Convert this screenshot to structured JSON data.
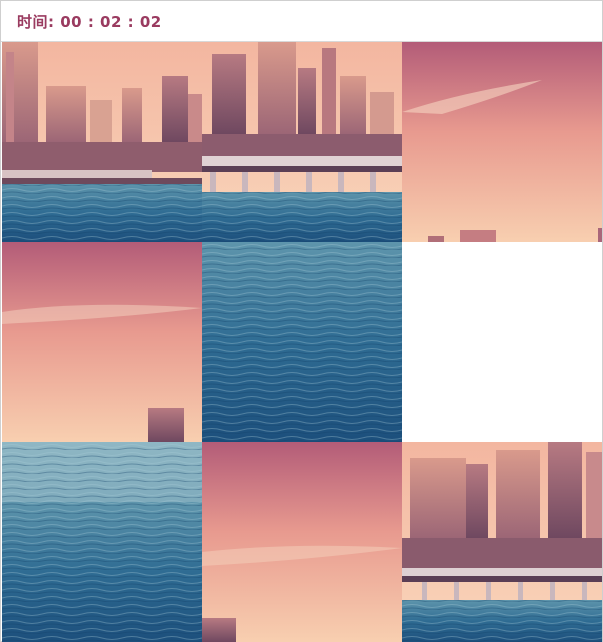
{
  "header": {
    "timer_label": "时间:",
    "timer_value": "00 : 02 : 02"
  },
  "puzzle": {
    "grid": "3x3",
    "tiles": [
      {
        "slot": 1,
        "piece": "top-left"
      },
      {
        "slot": 2,
        "piece": "top-center"
      },
      {
        "slot": 3,
        "piece": "top-right"
      },
      {
        "slot": 4,
        "piece": "middle-left"
      },
      {
        "slot": 5,
        "piece": "bottom-center"
      },
      {
        "slot": 6,
        "piece": "empty"
      },
      {
        "slot": 7,
        "piece": "bottom-left"
      },
      {
        "slot": 8,
        "piece": "middle-center"
      },
      {
        "slot": 9,
        "piece": "middle-right"
      }
    ]
  },
  "colors": {
    "timer_text": "#9a3b60",
    "sky_top": "#b8607a",
    "sky_bottom": "#f6c6a6",
    "water_light": "#6aa2b7",
    "water_dark": "#1f5580"
  }
}
